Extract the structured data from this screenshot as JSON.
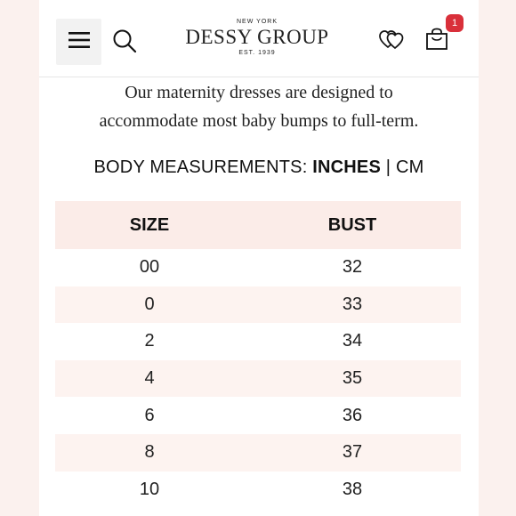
{
  "header": {
    "logo_top": "NEW YORK",
    "logo_brand": "DESSY GROUP",
    "logo_est": "EST. 1939",
    "cart_count": "1",
    "icons": [
      "menu-icon",
      "search-icon",
      "wishlist-hearts-icon",
      "shopping-bag-icon"
    ],
    "badge_color": "#d9303a"
  },
  "intro": {
    "line1": "Our maternity dresses are designed to",
    "line2": "accommodate most baby bumps to full-term."
  },
  "measurements": {
    "label": "BODY MEASUREMENTS:",
    "unit_inches": "INCHES",
    "separator": "|",
    "unit_cm": "CM"
  },
  "table": {
    "headers": [
      "SIZE",
      "BUST"
    ],
    "rows": [
      [
        "00",
        "32"
      ],
      [
        "0",
        "33"
      ],
      [
        "2",
        "34"
      ],
      [
        "4",
        "35"
      ],
      [
        "6",
        "36"
      ],
      [
        "8",
        "37"
      ],
      [
        "10",
        "38"
      ]
    ]
  }
}
